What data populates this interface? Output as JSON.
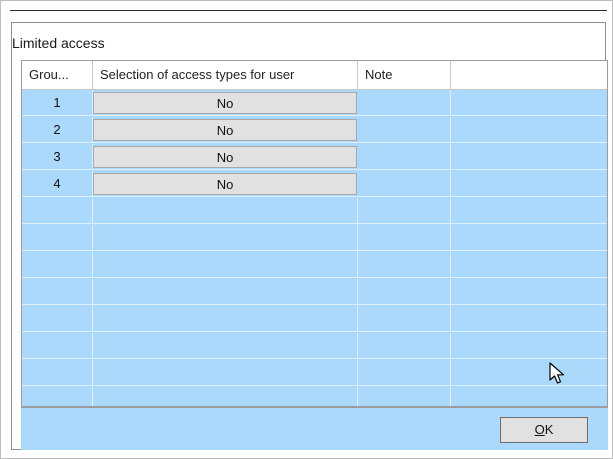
{
  "dialog": {
    "title": "Limited access"
  },
  "table": {
    "columns": [
      "Grou...",
      "Selection of access types for user",
      "Note",
      ""
    ],
    "rows": [
      {
        "group": "1",
        "selection": "No",
        "note": ""
      },
      {
        "group": "2",
        "selection": "No",
        "note": ""
      },
      {
        "group": "3",
        "selection": "No",
        "note": ""
      },
      {
        "group": "4",
        "selection": "No",
        "note": ""
      }
    ],
    "empty_row_count": 8
  },
  "footer": {
    "ok_label_first": "O",
    "ok_label_rest": "K"
  },
  "colors": {
    "grid_background": "#aad9fb",
    "button_face": "#e1e1e1"
  },
  "icons": {
    "cursor": "mouse-pointer-icon"
  }
}
